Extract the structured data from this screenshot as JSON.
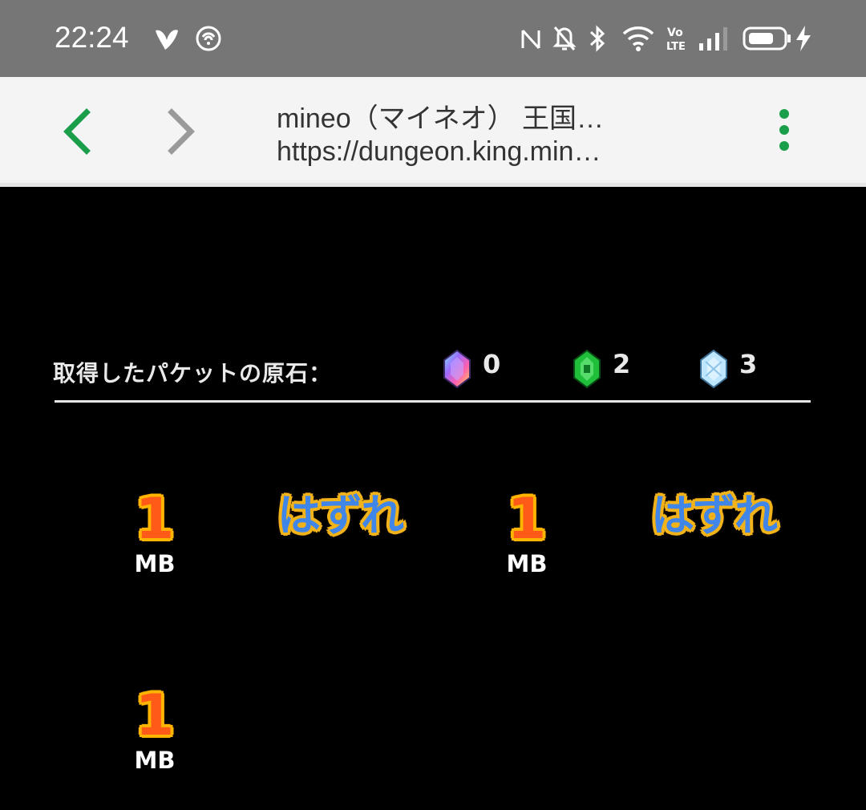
{
  "status_bar": {
    "time": "22:24",
    "icons": [
      "mineo-logo-icon",
      "sync-icon",
      "nfc-icon",
      "mute-icon",
      "bluetooth-icon",
      "wifi-icon",
      "volte-icon",
      "signal-icon",
      "battery-icon",
      "charging-icon"
    ],
    "volte_text": "Vo LTE"
  },
  "browser": {
    "title": "mineo（マイネオ） 王国…",
    "url": "https://dungeon.king.min…",
    "accent_color": "#1a9e4a"
  },
  "game": {
    "stones_label": "取得したパケットの原石：",
    "stones": [
      {
        "icon": "rainbow-gem-icon",
        "count": "0"
      },
      {
        "icon": "green-gem-icon",
        "count": "2"
      },
      {
        "icon": "blue-gem-icon",
        "count": "3"
      }
    ],
    "rewards": [
      {
        "value": "1",
        "unit": "MB"
      },
      {
        "value": "1",
        "unit": "MB"
      },
      {
        "value": "1",
        "unit": "MB"
      }
    ],
    "misses": [
      "はずれ",
      "はずれ"
    ]
  }
}
